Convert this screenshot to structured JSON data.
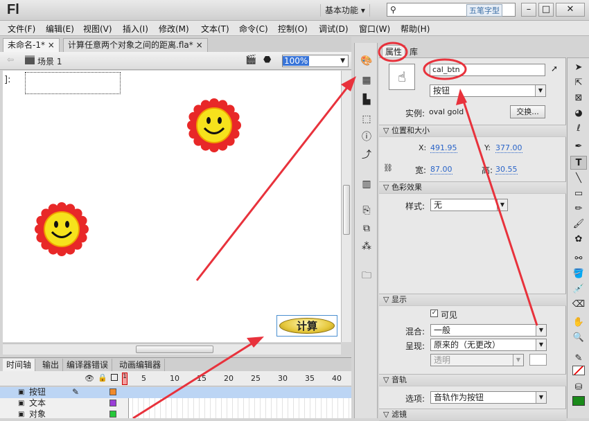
{
  "app": {
    "logo": "Fl",
    "workspace": "基本功能",
    "search_watermark": "五笔字型"
  },
  "menu": [
    "文件(F)",
    "编辑(E)",
    "视图(V)",
    "插入(I)",
    "修改(M)",
    "文本(T)",
    "命令(C)",
    "控制(O)",
    "调试(D)",
    "窗口(W)",
    "帮助(H)"
  ],
  "doc_tabs": [
    "未命名-1*",
    "计算任意两个对象之间的距离.fla*"
  ],
  "scene": {
    "label": "场景 1",
    "zoom": "100%",
    "stage_fragment": "]:"
  },
  "stage": {
    "button_text": "计算"
  },
  "timeline": {
    "tabs": [
      "时间轴",
      "输出",
      "编译器错误",
      "动画编辑器"
    ],
    "frames": [
      "1",
      "5",
      "10",
      "15",
      "20",
      "25",
      "30",
      "35",
      "40"
    ],
    "layers": [
      "按钮",
      "文本",
      "对象"
    ]
  },
  "panel": {
    "tabs": [
      "属性",
      "库"
    ],
    "instance_name": "cal_btn",
    "type": "按钮",
    "instance_label": "实例:",
    "instance_of": "oval gold",
    "swap": "交换...",
    "section_pos": "位置和大小",
    "x_label": "X:",
    "x": "491.95",
    "y_label": "Y:",
    "y": "377.00",
    "w_label": "宽:",
    "w": "87.00",
    "h_label": "高:",
    "h": "30.55",
    "section_color": "色彩效果",
    "style_label": "样式:",
    "style": "无",
    "section_display": "显示",
    "visible": "可见",
    "blend_label": "混合:",
    "blend": "一般",
    "render_label": "呈现:",
    "render": "原来的（无更改）",
    "transparent": "透明",
    "section_track": "音轨",
    "options_label": "选项:",
    "options": "音轨作为按钮",
    "section_filter": "滤镜"
  },
  "colors": {
    "accent": "#3874d8",
    "annotation": "#e8323c",
    "layer_selected": "#bcd5f4"
  }
}
